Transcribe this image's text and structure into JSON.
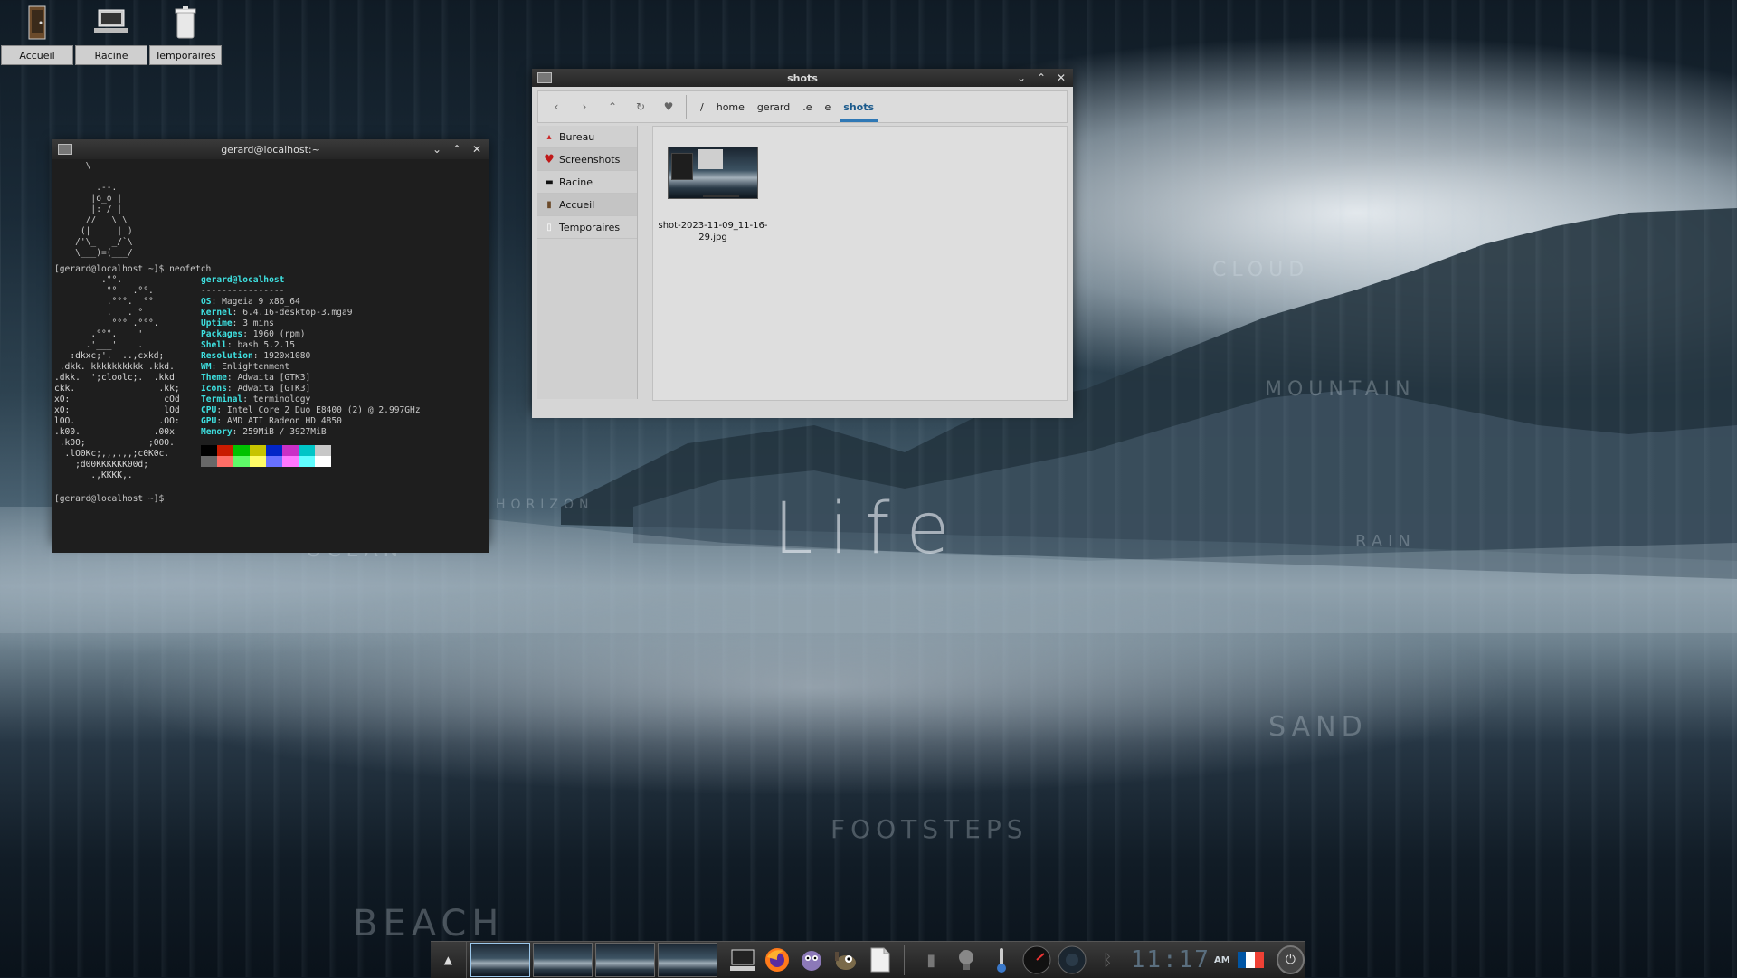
{
  "desktop": {
    "icons": [
      {
        "label": "Accueil",
        "icon": "home-icon"
      },
      {
        "label": "Racine",
        "icon": "computer-icon"
      },
      {
        "label": "Temporaires",
        "icon": "trash-icon"
      }
    ],
    "wallpaper_words": [
      "CLOUD",
      "MOUNTAIN",
      "OCEAN",
      "HORIZON",
      "SAND",
      "FOOTSTEPS",
      "BEACH",
      "RAIN"
    ],
    "wallpaper_title": "Life"
  },
  "terminal": {
    "title": "gerard@localhost:~",
    "tux_art": "      \\\n\n        .--.\n       |o_o |\n       |:_/ |\n      //   \\ \\\n     (|     | )\n    /'\\_   _/`\\\n    \\___)=(___/",
    "prompt1": "[gerard@localhost ~]$ neofetch",
    "logo_art": "         .°°.\n          °°   .°°.\n          .°°°.  °°\n          .   . °\n           °°° .°°°.\n       .°°°.    '\n      .'___'    .\n   :dkxc;'.  ..,cxkd;\n .dkk. kkkkkkkkkk .kkd.\n.dkk.  ';cloolc;.  .kkd\nckk.                .kk;\nxO:                  cOd\nxO:                  lOd\nlOO.                .OO:\n.k00.              .00x\n .k00;            ;00O.\n  .lO0Kc;,,,,,,;c0K0c.\n    ;d00KKKKKK00d;\n       .,KKKK,.",
    "user_host": "gerard@localhost",
    "divider": "----------------",
    "info": [
      {
        "key": "OS",
        "value": "Mageia 9 x86_64"
      },
      {
        "key": "Kernel",
        "value": "6.4.16-desktop-3.mga9"
      },
      {
        "key": "Uptime",
        "value": "3 mins"
      },
      {
        "key": "Packages",
        "value": "1960 (rpm)"
      },
      {
        "key": "Shell",
        "value": "bash 5.2.15"
      },
      {
        "key": "Resolution",
        "value": "1920x1080"
      },
      {
        "key": "WM",
        "value": "Enlightenment"
      },
      {
        "key": "Theme",
        "value": "Adwaita [GTK3]"
      },
      {
        "key": "Icons",
        "value": "Adwaita [GTK3]"
      },
      {
        "key": "Terminal",
        "value": "terminology"
      },
      {
        "key": "CPU",
        "value": "Intel Core 2 Duo E8400 (2) @ 2.997GHz"
      },
      {
        "key": "GPU",
        "value": "AMD ATI Radeon HD 4850"
      },
      {
        "key": "Memory",
        "value": "259MiB / 3927MiB"
      }
    ],
    "swatch_colors_top": [
      "#000000",
      "#c91b00",
      "#00c200",
      "#c7c400",
      "#0225c7",
      "#c930c7",
      "#00c5c7",
      "#c7c7c7"
    ],
    "swatch_colors_bottom": [
      "#686868",
      "#ff6e67",
      "#5ffa68",
      "#fffc67",
      "#6871ff",
      "#ff77ff",
      "#60fdff",
      "#ffffff"
    ],
    "prompt2": "[gerard@localhost ~]$"
  },
  "filemanager": {
    "title": "shots",
    "nav_icons": [
      "back-icon",
      "forward-icon",
      "up-icon",
      "refresh-icon",
      "bookmark-icon"
    ],
    "breadcrumbs": [
      "/",
      "home",
      "gerard",
      ".e",
      "e",
      "shots"
    ],
    "sidebar": [
      {
        "label": "Bureau",
        "icon": "desktop-icon"
      },
      {
        "label": "Screenshots",
        "icon": "heart-icon"
      },
      {
        "label": "Racine",
        "icon": "computer-icon"
      },
      {
        "label": "Accueil",
        "icon": "home-icon"
      },
      {
        "label": "Temporaires",
        "icon": "trash-icon"
      }
    ],
    "files": [
      {
        "name": "shot-2023-11-09_11-16-29.jpg"
      }
    ]
  },
  "taskbar": {
    "clock": "11:17",
    "ampm": "AM",
    "flag_colors": [
      "#0055a4",
      "#ffffff",
      "#ef4135"
    ],
    "apps": [
      "terminal-icon",
      "firefox-icon",
      "pidgin-icon",
      "gimp-icon",
      "files-icon"
    ]
  }
}
